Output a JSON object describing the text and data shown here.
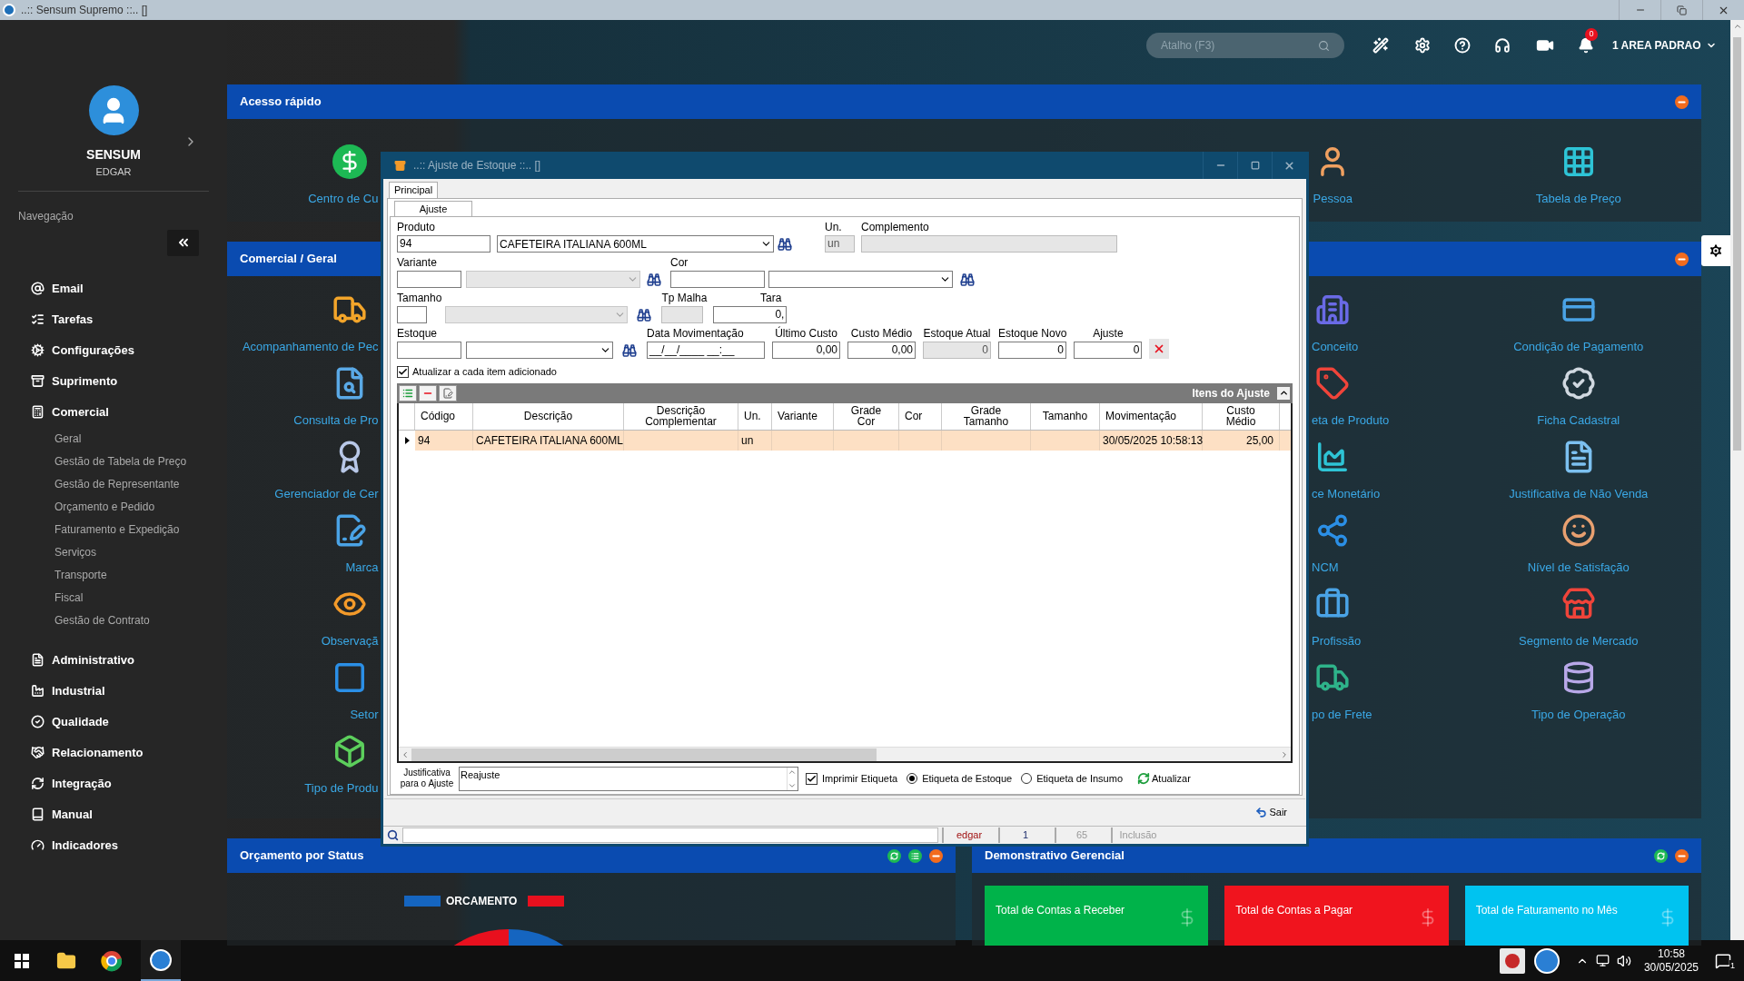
{
  "window": {
    "title": "..:: Sensum Supremo ::.. []"
  },
  "header": {
    "search": {
      "placeholder": "Atalho (F3)"
    },
    "notification_count": "0",
    "area": "1 AREA PADRAO"
  },
  "sidebar": {
    "user": "SENSUM",
    "subtitle": "EDGAR",
    "section": "Navegação",
    "items": [
      {
        "label": "Email"
      },
      {
        "label": "Tarefas"
      },
      {
        "label": "Configurações"
      },
      {
        "label": "Suprimento"
      },
      {
        "label": "Comercial",
        "children": [
          {
            "label": "Geral"
          },
          {
            "label": "Gestão de Tabela de Preço"
          },
          {
            "label": "Gestão de Representante"
          },
          {
            "label": "Orçamento e Pedido"
          },
          {
            "label": "Faturamento e Expedição"
          },
          {
            "label": "Serviços"
          },
          {
            "label": "Transporte"
          },
          {
            "label": "Fiscal"
          },
          {
            "label": "Gestão de Contrato"
          }
        ]
      },
      {
        "label": "Administrativo"
      },
      {
        "label": "Industrial"
      },
      {
        "label": "Qualidade"
      },
      {
        "label": "Relacionamento"
      },
      {
        "label": "Integração"
      },
      {
        "label": "Manual"
      },
      {
        "label": "Indicadores"
      }
    ]
  },
  "quick_access": {
    "title": "Acesso rápido",
    "left_tiles": [
      {
        "label": "Centro de Cu"
      }
    ],
    "middle_tiles": [
      {
        "label": "Pessoa"
      }
    ],
    "right_tiles": [
      {
        "label": "Tabela de Preço"
      }
    ]
  },
  "comercial": {
    "title": "Comercial / Geral",
    "left_tiles": [
      {
        "label": "Acompanhamento de Pec"
      },
      {
        "label": "Consulta de Pro"
      },
      {
        "label": "Gerenciador de Cer"
      },
      {
        "label": "Marca"
      },
      {
        "label": "Observaçã"
      },
      {
        "label": "Setor"
      },
      {
        "label": "Tipo de Produ"
      }
    ],
    "middle_tiles": [
      {
        "label": "Conceito"
      },
      {
        "label": "eta de Produto"
      },
      {
        "label": "ce Monetário"
      },
      {
        "label": "NCM"
      },
      {
        "label": "Profissão"
      },
      {
        "label": "po de Frete"
      }
    ],
    "right_tiles": [
      {
        "label": "Condição de Pagamento"
      },
      {
        "label": "Ficha Cadastral"
      },
      {
        "label": "Justificativa de Não Venda"
      },
      {
        "label": "Nível de Satisfação"
      },
      {
        "label": "Segmento de Mercado"
      },
      {
        "label": "Tipo de Operação"
      }
    ]
  },
  "status_panel": {
    "title": "Orçamento por Status",
    "legend": [
      {
        "label": "ORCAMENTO",
        "color": "#1565c0"
      }
    ]
  },
  "management": {
    "title": "Demonstrativo Gerencial",
    "cards": [
      {
        "label": "Total de Contas a Receber",
        "color": "#00b34a"
      },
      {
        "label": "Total de Contas a Pagar",
        "color": "#f0141e"
      },
      {
        "label": "Total de Faturamento no Mês",
        "color": "#00c3f0"
      }
    ]
  },
  "dialog": {
    "title": "..:: Ajuste de Estoque ::.. []",
    "tabs": [
      {
        "label": "Principal",
        "selected": true
      }
    ],
    "subtabs": [
      {
        "label": "Ajuste",
        "selected": true
      }
    ],
    "form": {
      "produto": {
        "label": "Produto",
        "code": "94",
        "description": "CAFETEIRA ITALIANA 600ML"
      },
      "un": {
        "label": "Un.",
        "value": "un",
        "disabled": true
      },
      "complemento": {
        "label": "Complemento",
        "disabled": true
      },
      "variante": {
        "label": "Variante",
        "disabled": true
      },
      "cor": {
        "label": "Cor"
      },
      "tamanho": {
        "label": "Tamanho",
        "disabled": true
      },
      "tp_malha": {
        "label": "Tp Malha",
        "disabled": true
      },
      "tara": {
        "label": "Tara",
        "value": "0,"
      },
      "estoque": {
        "label": "Estoque"
      },
      "data_movimentacao": {
        "label": "Data Movimentação",
        "value": "__/__/____ __:__"
      },
      "values": [
        {
          "label": "Último Custo",
          "value": "0,00",
          "disabled": false
        },
        {
          "label": "Custo Médio",
          "value": "0,00",
          "disabled": false
        },
        {
          "label": "Estoque Atual",
          "value": "0",
          "disabled": true
        },
        {
          "label": "Estoque Novo",
          "value": "0",
          "disabled": false
        },
        {
          "label": "Ajuste",
          "value": "0",
          "disabled": false
        }
      ]
    },
    "update_each": {
      "label": "Atualizar a cada item adicionado",
      "checked": true
    },
    "grid": {
      "title": "Itens do Ajuste",
      "columns": [
        {
          "label": "Código",
          "values": [
            "94"
          ]
        },
        {
          "label": "Descrição",
          "values": [
            "CAFETEIRA ITALIANA 600ML"
          ]
        },
        {
          "label": "Descrição Complementar"
        },
        {
          "label": "Un.",
          "values": [
            "un"
          ]
        },
        {
          "label": "Variante"
        },
        {
          "label": "Grade Cor"
        },
        {
          "label": "Cor"
        },
        {
          "label": "Grade Tamanho"
        },
        {
          "label": "Tamanho"
        },
        {
          "label": "Movimentação",
          "values": [
            "30/05/2025 10:58:13"
          ]
        },
        {
          "label": "Custo Médio",
          "values": [
            "25,00"
          ]
        }
      ],
      "rows": [
        {
          "selected": true
        }
      ]
    },
    "justification": {
      "label": "Justificativa para o Ajuste",
      "value": "Reajuste"
    },
    "print_label": {
      "label": "Imprimir Etiqueta",
      "checked": true
    },
    "label_types": [
      {
        "label": "Etiqueta de Estoque",
        "selected": true
      },
      {
        "label": "Etiqueta de Insumo",
        "selected": false
      }
    ],
    "refresh_button": "Atualizar",
    "exit_button": "Sair",
    "status_bar": [
      "edgar",
      "1",
      "65",
      "Inclusão"
    ]
  },
  "taskbar": {
    "time": "10:58",
    "date": "30/05/2025",
    "notification_count": "1"
  }
}
